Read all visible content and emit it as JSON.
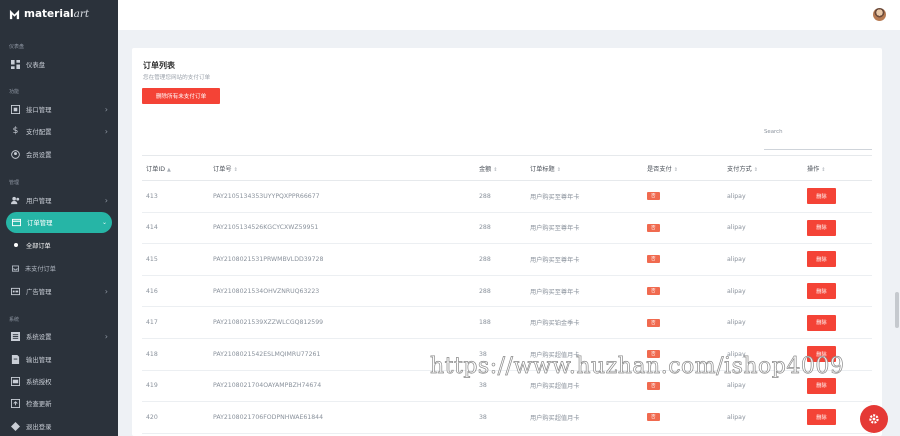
{
  "app": {
    "brand": "material",
    "brand_script": "art"
  },
  "sidebar": {
    "sections": {
      "dashboard": "仪表盘",
      "function": "功能",
      "manage": "管理",
      "system": "系统"
    },
    "items": [
      {
        "label": "仪表盘"
      },
      {
        "label": "接口管理"
      },
      {
        "label": "支付配置"
      },
      {
        "label": "会员设置"
      },
      {
        "label": "用户管理"
      },
      {
        "label": "订单管理"
      },
      {
        "label": "全部订单"
      },
      {
        "label": "未支付订单"
      },
      {
        "label": "广告管理"
      },
      {
        "label": "系统设置"
      },
      {
        "label": "输出管理"
      },
      {
        "label": "系统授权"
      },
      {
        "label": "检查更新"
      },
      {
        "label": "退出登录"
      }
    ]
  },
  "page": {
    "title": "订单列表",
    "subtitle": "您在管理您网站的支付订单",
    "delete_all": "删除所有未支付订单",
    "search_label": "Search"
  },
  "table": {
    "columns": [
      "订单ID",
      "订单号",
      "金额",
      "订单标题",
      "是否支付",
      "支付方式",
      "操作"
    ],
    "delete_label": "删除",
    "rows": [
      {
        "id": "413",
        "no": "PAY2105134353UYYPQXPPR66677",
        "amount": "288",
        "title": "用户购买至尊年卡",
        "paid": "否",
        "method": "alipay"
      },
      {
        "id": "414",
        "no": "PAY2105134526KGCYCXWZ59951",
        "amount": "288",
        "title": "用户购买至尊年卡",
        "paid": "否",
        "method": "alipay"
      },
      {
        "id": "415",
        "no": "PAY2108021531PRWMBVLDD39728",
        "amount": "288",
        "title": "用户购买至尊年卡",
        "paid": "否",
        "method": "alipay"
      },
      {
        "id": "416",
        "no": "PAY2108021534OHVZNRUQ63223",
        "amount": "288",
        "title": "用户购买至尊年卡",
        "paid": "否",
        "method": "alipay"
      },
      {
        "id": "417",
        "no": "PAY2108021539XZZWLCGQ812599",
        "amount": "188",
        "title": "用户购买铂金季卡",
        "paid": "否",
        "method": "alipay"
      },
      {
        "id": "418",
        "no": "PAY2108021542ESLMQIMRU77261",
        "amount": "38",
        "title": "用户购买超值月卡",
        "paid": "否",
        "method": "alipay"
      },
      {
        "id": "419",
        "no": "PAY2108021704OAYAMPBZH74674",
        "amount": "38",
        "title": "用户购买超值月卡",
        "paid": "否",
        "method": "alipay"
      },
      {
        "id": "420",
        "no": "PAY2108021706FODPNHWAE61844",
        "amount": "38",
        "title": "用户购买超值月卡",
        "paid": "否",
        "method": "alipay"
      }
    ]
  },
  "watermark": "https://www.huzhan.com/ishop4009",
  "colors": {
    "sidebar": "#2b323b",
    "accent": "#26b5a6",
    "danger": "#f44336"
  }
}
